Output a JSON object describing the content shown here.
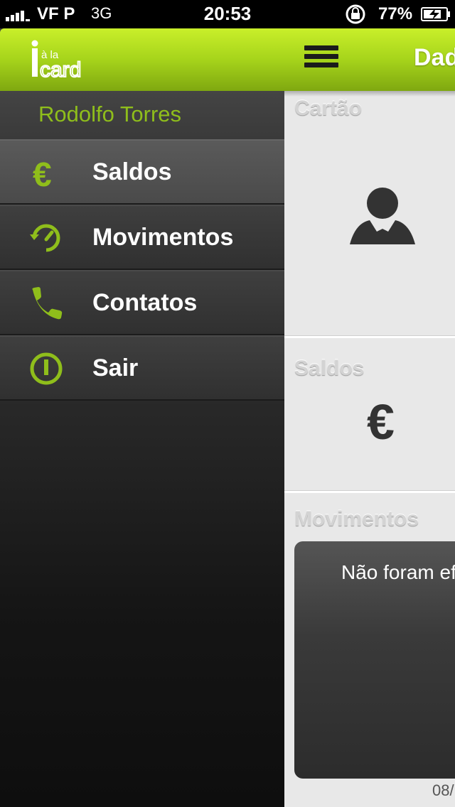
{
  "status_bar": {
    "carrier": "VF P",
    "network": "3G",
    "time": "20:53",
    "battery_percent": "77%",
    "icons": [
      "signal-icon",
      "rotation-lock-icon",
      "battery-charging-icon"
    ]
  },
  "sidebar": {
    "logo_alt": "à la card",
    "user_name": "Rodolfo Torres",
    "items": [
      {
        "label": "Saldos",
        "icon": "euro-icon",
        "active": true
      },
      {
        "label": "Movimentos",
        "icon": "history-icon",
        "active": false
      },
      {
        "label": "Contatos",
        "icon": "phone-icon",
        "active": false
      },
      {
        "label": "Sair",
        "icon": "power-icon",
        "active": false
      }
    ]
  },
  "main": {
    "header_title": "Dad",
    "sections": {
      "card": {
        "title": "Cartão",
        "icon": "person-icon"
      },
      "balances": {
        "title": "Saldos",
        "symbol": "€"
      },
      "movements": {
        "title": "Movimentos",
        "message": "Não foram ef",
        "date": "08/"
      }
    }
  },
  "colors": {
    "accent_green": "#a6d41b",
    "sidebar_text_green": "#8fbe1b",
    "dark_bg": "#2b2b2b",
    "light_bg": "#e8e8e8"
  }
}
